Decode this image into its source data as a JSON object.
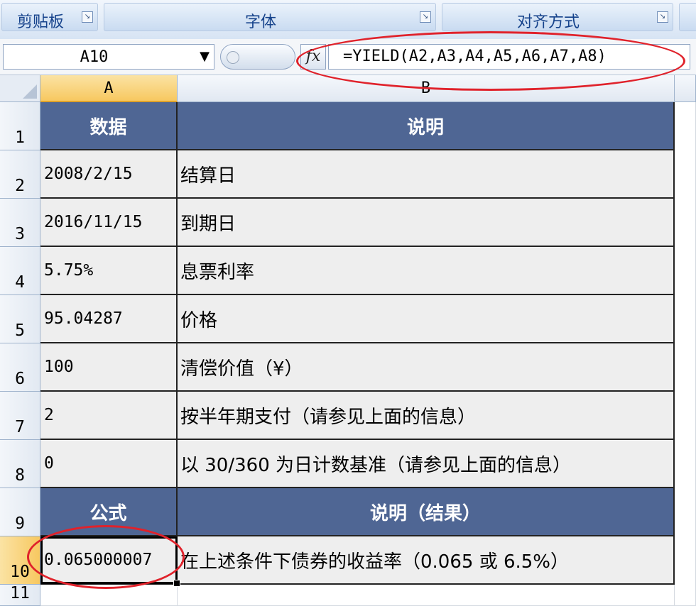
{
  "ribbon": {
    "groups": [
      {
        "label": "剪贴板"
      },
      {
        "label": "字体"
      },
      {
        "label": "对齐方式"
      }
    ],
    "launcher_icon": "dialog-launcher-icon"
  },
  "formula_bar": {
    "name_box": "A10",
    "fx_label": "fx",
    "formula": "=YIELD(A2,A3,A4,A5,A6,A7,A8)"
  },
  "columns": [
    "A",
    "B"
  ],
  "row_numbers": [
    "1",
    "2",
    "3",
    "4",
    "5",
    "6",
    "7",
    "8",
    "9",
    "10",
    "11"
  ],
  "rows": [
    {
      "a": "数据",
      "b": "说明",
      "header": true
    },
    {
      "a": "2008/2/15",
      "b": "结算日"
    },
    {
      "a": "2016/11/15",
      "b": "到期日"
    },
    {
      "a": "5.75%",
      "b": "息票利率"
    },
    {
      "a": "95.04287",
      "b": "价格"
    },
    {
      "a": "100",
      "b": "清偿价值（¥）"
    },
    {
      "a": "2",
      "b": "按半年期支付（请参见上面的信息）"
    },
    {
      "a": "0",
      "b": "以 30/360 为日计数基准（请参见上面的信息）"
    },
    {
      "a": "公式",
      "b": "说明（结果）",
      "header": true
    },
    {
      "a": "0.065000007",
      "b": "在上述条件下债券的收益率（0.065 或 6.5%）"
    }
  ],
  "selection": {
    "active_cell": "A10",
    "active_column": "A",
    "active_row": "10"
  },
  "colors": {
    "header_fill": "#4f6694",
    "data_fill": "#eeeeee",
    "annotation_red": "#e0222b",
    "selection_orange": "#f7c860"
  }
}
